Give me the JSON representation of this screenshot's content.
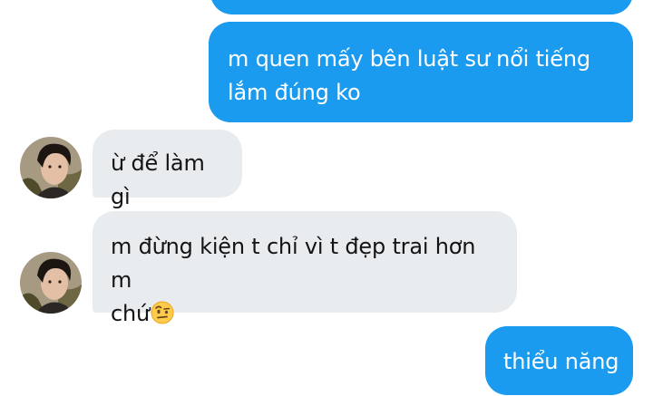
{
  "chat": {
    "colors": {
      "outgoing_bubble": "#1a9bf0",
      "incoming_bubble": "#e9ecef",
      "outgoing_text": "#ffffff",
      "incoming_text": "#141414"
    },
    "messages": [
      {
        "sender": "me",
        "lines": [
          "m quen mấy bên luật sư nổi tiếng",
          "lắm đúng ko"
        ]
      },
      {
        "sender": "contact",
        "lines": [
          "ừ để làm gì"
        ],
        "avatar_icon": "contact-avatar"
      },
      {
        "sender": "contact",
        "lines": [
          "m đừng kiện t chỉ vì t đẹp trai hơn m",
          "chứ"
        ],
        "emoji": "raised-eyebrow-emoji",
        "avatar_icon": "contact-avatar"
      },
      {
        "sender": "me",
        "lines": [
          "thiểu năng"
        ]
      }
    ]
  }
}
